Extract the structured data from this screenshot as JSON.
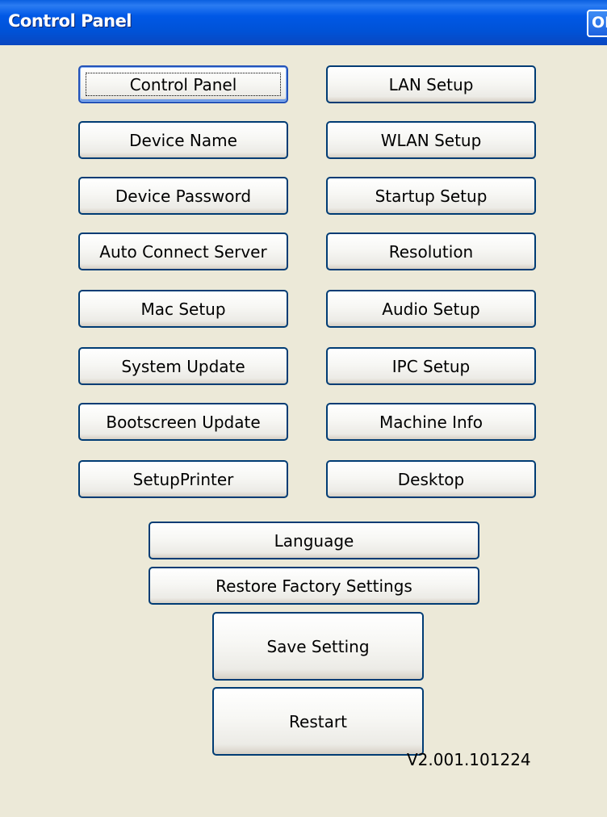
{
  "window": {
    "title": "Control Panel",
    "ok_label": "OK"
  },
  "buttons": {
    "left": [
      "Control Panel",
      "Device Name",
      "Device Password",
      "Auto Connect Server",
      "Mac Setup",
      "System Update",
      "Bootscreen Update",
      "SetupPrinter"
    ],
    "right": [
      "LAN Setup",
      "WLAN Setup",
      "Startup Setup",
      "Resolution",
      "Audio Setup",
      "IPC Setup",
      "Machine Info",
      "Desktop"
    ],
    "language": "Language",
    "restore": "Restore Factory Settings",
    "save": "Save Setting",
    "restart": "Restart"
  },
  "version": "V2.001.101224",
  "colors": {
    "titlebar": "#0058e6",
    "background": "#ece9d8",
    "button_border": "#003c74"
  }
}
